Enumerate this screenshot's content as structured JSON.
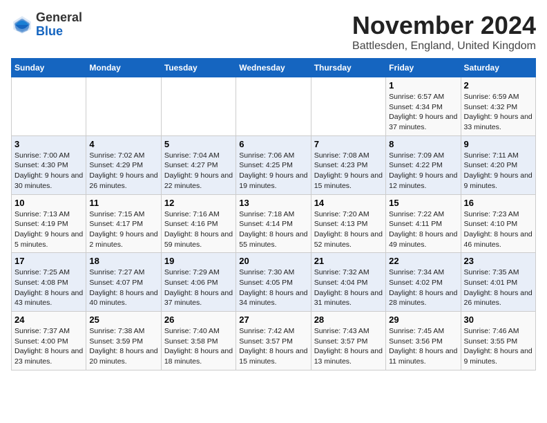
{
  "logo": {
    "general": "General",
    "blue": "Blue"
  },
  "header": {
    "month": "November 2024",
    "location": "Battlesden, England, United Kingdom"
  },
  "weekdays": [
    "Sunday",
    "Monday",
    "Tuesday",
    "Wednesday",
    "Thursday",
    "Friday",
    "Saturday"
  ],
  "weeks": [
    [
      {
        "day": "",
        "info": ""
      },
      {
        "day": "",
        "info": ""
      },
      {
        "day": "",
        "info": ""
      },
      {
        "day": "",
        "info": ""
      },
      {
        "day": "",
        "info": ""
      },
      {
        "day": "1",
        "info": "Sunrise: 6:57 AM\nSunset: 4:34 PM\nDaylight: 9 hours and 37 minutes."
      },
      {
        "day": "2",
        "info": "Sunrise: 6:59 AM\nSunset: 4:32 PM\nDaylight: 9 hours and 33 minutes."
      }
    ],
    [
      {
        "day": "3",
        "info": "Sunrise: 7:00 AM\nSunset: 4:30 PM\nDaylight: 9 hours and 30 minutes."
      },
      {
        "day": "4",
        "info": "Sunrise: 7:02 AM\nSunset: 4:29 PM\nDaylight: 9 hours and 26 minutes."
      },
      {
        "day": "5",
        "info": "Sunrise: 7:04 AM\nSunset: 4:27 PM\nDaylight: 9 hours and 22 minutes."
      },
      {
        "day": "6",
        "info": "Sunrise: 7:06 AM\nSunset: 4:25 PM\nDaylight: 9 hours and 19 minutes."
      },
      {
        "day": "7",
        "info": "Sunrise: 7:08 AM\nSunset: 4:23 PM\nDaylight: 9 hours and 15 minutes."
      },
      {
        "day": "8",
        "info": "Sunrise: 7:09 AM\nSunset: 4:22 PM\nDaylight: 9 hours and 12 minutes."
      },
      {
        "day": "9",
        "info": "Sunrise: 7:11 AM\nSunset: 4:20 PM\nDaylight: 9 hours and 9 minutes."
      }
    ],
    [
      {
        "day": "10",
        "info": "Sunrise: 7:13 AM\nSunset: 4:19 PM\nDaylight: 9 hours and 5 minutes."
      },
      {
        "day": "11",
        "info": "Sunrise: 7:15 AM\nSunset: 4:17 PM\nDaylight: 9 hours and 2 minutes."
      },
      {
        "day": "12",
        "info": "Sunrise: 7:16 AM\nSunset: 4:16 PM\nDaylight: 8 hours and 59 minutes."
      },
      {
        "day": "13",
        "info": "Sunrise: 7:18 AM\nSunset: 4:14 PM\nDaylight: 8 hours and 55 minutes."
      },
      {
        "day": "14",
        "info": "Sunrise: 7:20 AM\nSunset: 4:13 PM\nDaylight: 8 hours and 52 minutes."
      },
      {
        "day": "15",
        "info": "Sunrise: 7:22 AM\nSunset: 4:11 PM\nDaylight: 8 hours and 49 minutes."
      },
      {
        "day": "16",
        "info": "Sunrise: 7:23 AM\nSunset: 4:10 PM\nDaylight: 8 hours and 46 minutes."
      }
    ],
    [
      {
        "day": "17",
        "info": "Sunrise: 7:25 AM\nSunset: 4:08 PM\nDaylight: 8 hours and 43 minutes."
      },
      {
        "day": "18",
        "info": "Sunrise: 7:27 AM\nSunset: 4:07 PM\nDaylight: 8 hours and 40 minutes."
      },
      {
        "day": "19",
        "info": "Sunrise: 7:29 AM\nSunset: 4:06 PM\nDaylight: 8 hours and 37 minutes."
      },
      {
        "day": "20",
        "info": "Sunrise: 7:30 AM\nSunset: 4:05 PM\nDaylight: 8 hours and 34 minutes."
      },
      {
        "day": "21",
        "info": "Sunrise: 7:32 AM\nSunset: 4:04 PM\nDaylight: 8 hours and 31 minutes."
      },
      {
        "day": "22",
        "info": "Sunrise: 7:34 AM\nSunset: 4:02 PM\nDaylight: 8 hours and 28 minutes."
      },
      {
        "day": "23",
        "info": "Sunrise: 7:35 AM\nSunset: 4:01 PM\nDaylight: 8 hours and 26 minutes."
      }
    ],
    [
      {
        "day": "24",
        "info": "Sunrise: 7:37 AM\nSunset: 4:00 PM\nDaylight: 8 hours and 23 minutes."
      },
      {
        "day": "25",
        "info": "Sunrise: 7:38 AM\nSunset: 3:59 PM\nDaylight: 8 hours and 20 minutes."
      },
      {
        "day": "26",
        "info": "Sunrise: 7:40 AM\nSunset: 3:58 PM\nDaylight: 8 hours and 18 minutes."
      },
      {
        "day": "27",
        "info": "Sunrise: 7:42 AM\nSunset: 3:57 PM\nDaylight: 8 hours and 15 minutes."
      },
      {
        "day": "28",
        "info": "Sunrise: 7:43 AM\nSunset: 3:57 PM\nDaylight: 8 hours and 13 minutes."
      },
      {
        "day": "29",
        "info": "Sunrise: 7:45 AM\nSunset: 3:56 PM\nDaylight: 8 hours and 11 minutes."
      },
      {
        "day": "30",
        "info": "Sunrise: 7:46 AM\nSunset: 3:55 PM\nDaylight: 8 hours and 9 minutes."
      }
    ]
  ]
}
